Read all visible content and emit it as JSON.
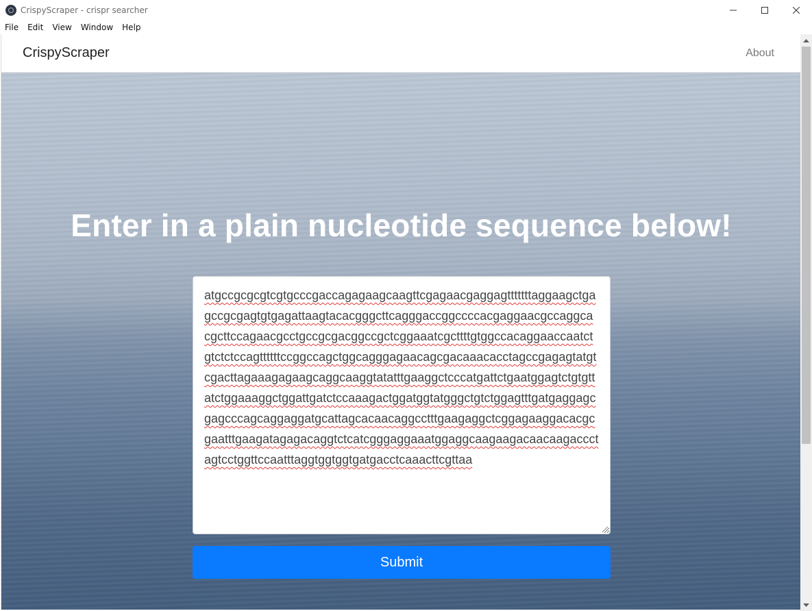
{
  "window": {
    "title": "CrispyScraper - crispr searcher",
    "minimize_glyph": "─",
    "maximize_glyph": "☐",
    "close_glyph": "✕"
  },
  "menu": {
    "items": [
      {
        "label": "File"
      },
      {
        "label": "Edit"
      },
      {
        "label": "View"
      },
      {
        "label": "Window"
      },
      {
        "label": "Help"
      }
    ]
  },
  "navbar": {
    "brand": "CrispyScraper",
    "about": "About"
  },
  "hero": {
    "headline": "Enter in a plain nucleotide sequence below!"
  },
  "form": {
    "sequence": "atgccgcgcgtcgtgcccgaccagagaagcaagttcgagaacgaggagtttttttaggaagctgagccgcgagtgtgagattaagtacacgggcttcagggaccggccccacgaggaacgccaggcacgcttccagaacgcctgccgcgacggccgctcggaaatcgcttttgtggccacaggaaccaatctgtctctccagttttttccggccagctggcagggagaacagcgacaaacacctagccgagagtatgtcgacttagaaagagaagcaggcaaggtatatttgaaggctcccatgattctgaatggagtctgtgttatctggaaaggctggattgatctccaaagactggatggtatgggctgtctggagtttgatgaggagcgagcccagcaggaggatgcattagcacaacaggcctttgaagaggctcggagaaggacacgcgaatttgaagatagagacaggtctcatcgggaggaaatggaggcaagaagacaacaagaccctagtcctggttccaatttaggtggtggtgatgacctcaaacttcgttaa",
    "submit_label": "Submit"
  },
  "colors": {
    "submit_bg": "#0a7aff",
    "headline": "#ffffff"
  }
}
